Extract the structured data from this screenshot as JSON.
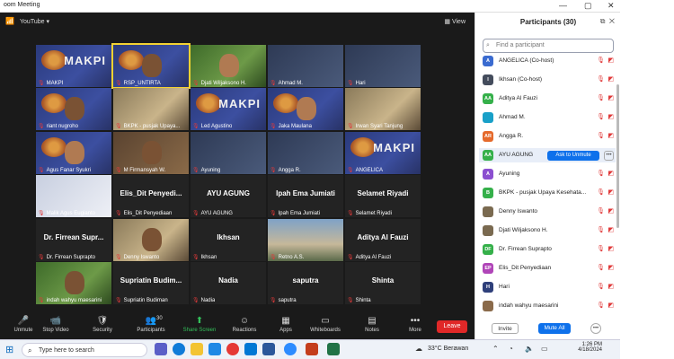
{
  "window": {
    "title": "oom Meeting"
  },
  "topbar": {
    "source": "YouTube",
    "view": "View"
  },
  "grid": [
    {
      "name": "MAKPI",
      "style": "vid-blue",
      "logo": true,
      "text": "MAKPI"
    },
    {
      "name": "RSP_UNTIRTA",
      "style": "vid-blue",
      "logo": true,
      "face": true,
      "highlight": true
    },
    {
      "name": "Djati Wiljaksono H.",
      "style": "vid-green",
      "face": true
    },
    {
      "name": "Ahmad M.",
      "style": "vid-dark"
    },
    {
      "name": "Hari",
      "style": "vid-dark"
    },
    {
      "name": "riant nugroho",
      "style": "vid-blue",
      "logo": true,
      "face": true
    },
    {
      "name": "BKPK - pusjak Upaya...",
      "style": "vid-photo"
    },
    {
      "name": "Led Agustino",
      "style": "vid-blue",
      "logo": true,
      "text": "MAKPI"
    },
    {
      "name": "Jaka Maulana",
      "style": "vid-blue",
      "logo": true,
      "face": true
    },
    {
      "name": "Irwan Syari Tanjung",
      "style": "vid-photo"
    },
    {
      "name": "Agus Fanar Syukri",
      "style": "vid-blue",
      "logo": true,
      "face": true
    },
    {
      "name": "M Firmansyah W.",
      "style": "vid-brown",
      "face": true
    },
    {
      "name": "Ayuning",
      "style": "vid-dark"
    },
    {
      "name": "Angga R.",
      "style": "vid-dark"
    },
    {
      "name": "ANGELICA",
      "style": "vid-blue",
      "logo": true,
      "text": "MAKPI"
    },
    {
      "name": "Malik Agus Eugianto",
      "style": "vid-light"
    },
    {
      "name": "Elis_Dit Penyediaan",
      "big": "Elis_Dit  Penyedi..."
    },
    {
      "name": "AYU AGUNG",
      "big": "AYU AGUNG"
    },
    {
      "name": "Ipah Ema Jumiati",
      "big": "Ipah Ema Jumiati"
    },
    {
      "name": "Selamet Riyadi",
      "big": "Selamet Riyadi"
    },
    {
      "name": "Dr. Firrean Suprapto",
      "big": "Dr. Firrean Supr..."
    },
    {
      "name": "Denny Iswanto",
      "style": "vid-photo",
      "face": true
    },
    {
      "name": "Ikhsan",
      "big": "Ikhsan"
    },
    {
      "name": "Retno A.S.",
      "style": "vid-sky"
    },
    {
      "name": "Aditya Al Fauzi",
      "big": "Aditya Al Fauzi"
    },
    {
      "name": "indah wahyu maesarini",
      "style": "vid-green",
      "face": true
    },
    {
      "name": "Supriatin Budiman",
      "big": "Supriatin  Budim..."
    },
    {
      "name": "Nadia",
      "big": "Nadia"
    },
    {
      "name": "saputra",
      "big": "saputra"
    },
    {
      "name": "Shinta",
      "big": "Shinta"
    }
  ],
  "toolbar": {
    "items": [
      {
        "label": "Unmute",
        "icon": "🎤"
      },
      {
        "label": "Stop Video",
        "icon": "📹"
      },
      {
        "label": "Security",
        "icon": "🛡"
      },
      {
        "label": "Participants",
        "icon": "👥",
        "count": "30"
      },
      {
        "label": "Share Screen",
        "icon": "⬆"
      },
      {
        "label": "Reactions",
        "icon": "☺"
      },
      {
        "label": "Apps",
        "icon": "▦"
      },
      {
        "label": "Whiteboards",
        "icon": "▭"
      },
      {
        "label": "Notes",
        "icon": "▤"
      },
      {
        "label": "More",
        "icon": "•••"
      }
    ],
    "leave": "Leave"
  },
  "panel": {
    "title": "Participants (30)",
    "search_placeholder": "Find a participant",
    "ask_unmute": "Ask to Unmute",
    "invite": "Invite",
    "mute_all": "Mute All",
    "participants": [
      {
        "name": "ANGELICA (Co-host)",
        "initials": "A",
        "color": "#3a6bd0"
      },
      {
        "name": "Ikhsan (Co-host)",
        "initials": "I",
        "color": "#444c5c"
      },
      {
        "name": "Aditya Al Fauzi",
        "initials": "AA",
        "color": "#35b04a"
      },
      {
        "name": "Ahmad M.",
        "initials": "",
        "color": "#19a0c8"
      },
      {
        "name": "Angga R.",
        "initials": "AR",
        "color": "#e56a2c"
      },
      {
        "name": "AYU AGUNG",
        "initials": "AA",
        "color": "#35b04a",
        "selected": true
      },
      {
        "name": "Ayuning",
        "initials": "A",
        "color": "#8b4fd0"
      },
      {
        "name": "BKPK - pusjak Upaya Kesehata...",
        "initials": "B",
        "color": "#35b04a"
      },
      {
        "name": "Denny Iswanto",
        "initials": "",
        "color": "#7a6a50"
      },
      {
        "name": "Djati Wiljaksono H.",
        "initials": "",
        "color": "#7a6a50"
      },
      {
        "name": "Dr. Firrean Suprapto",
        "initials": "DF",
        "color": "#35b04a"
      },
      {
        "name": "Elis_Dit Penyediaan",
        "initials": "EP",
        "color": "#b045b8"
      },
      {
        "name": "Hari",
        "initials": "H",
        "color": "#2e3f7a"
      },
      {
        "name": "indah wahyu maesarini",
        "initials": "",
        "color": "#8a6a4a"
      }
    ]
  },
  "taskbar": {
    "search": "Type here to search",
    "weather": "33°C  Berawan",
    "time": "1:26 PM",
    "date": "4/18/2024"
  }
}
